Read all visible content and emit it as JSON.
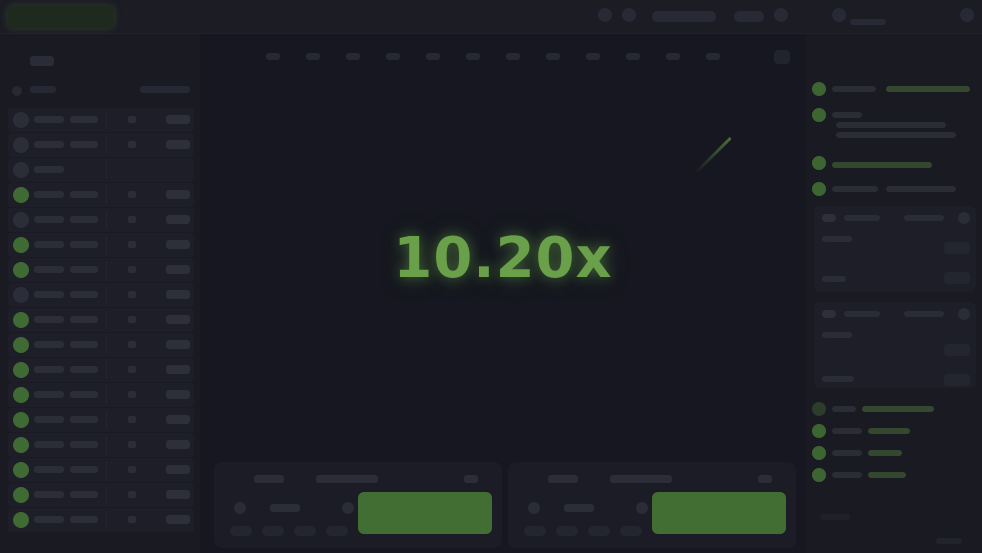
{
  "game": {
    "multiplier": "10.20x"
  },
  "colors": {
    "background": "#16171f",
    "panel": "#191a22",
    "accent_green": "#6aa049",
    "button_green": "#426e33"
  },
  "icons": {
    "logo": "logo-badge",
    "avatar": "player-avatar-icon",
    "menu": "menu-icon",
    "close": "close-icon",
    "user": "user-icon",
    "chat": "chat-icon"
  }
}
